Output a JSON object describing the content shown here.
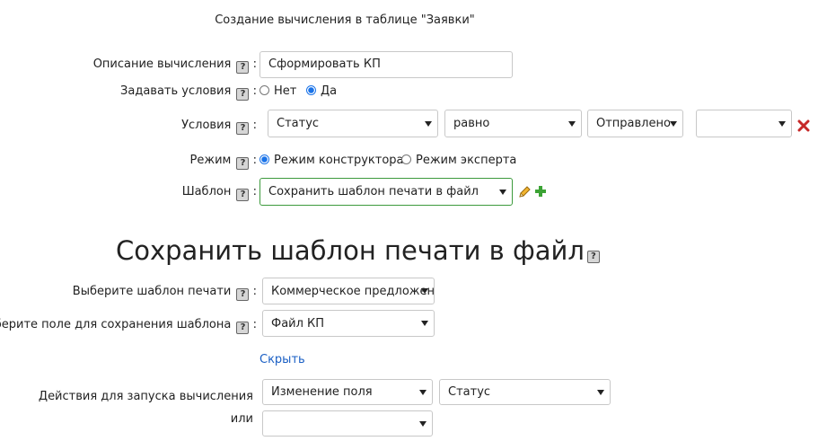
{
  "form_title": "Создание вычисления в таблице \"Заявки\"",
  "help_glyph": "?",
  "description": {
    "label": "Описание вычисления",
    "value": "Сформировать КП"
  },
  "set_conditions": {
    "label": "Задавать условия",
    "options": [
      {
        "label": "Нет",
        "selected": false
      },
      {
        "label": "Да",
        "selected": true
      }
    ]
  },
  "conditions": {
    "label": "Условия",
    "field": "Статус",
    "operator": "равно",
    "value": "Отправлено",
    "extra": ""
  },
  "mode": {
    "label": "Режим",
    "options": [
      {
        "label": "Режим конструктора",
        "selected": true
      },
      {
        "label": "Режим эксперта",
        "selected": false
      }
    ]
  },
  "template": {
    "label": "Шаблон",
    "value": "Сохранить шаблон печати в файл"
  },
  "section": {
    "heading": "Сохранить шаблон печати в файл",
    "print_template": {
      "label": "Выберите шаблон печати",
      "value": "Коммерческое предложение"
    },
    "save_field": {
      "label": "Выберите поле для сохранения шаблона",
      "value": "Файл КП"
    },
    "hide_link": "Скрыть",
    "triggers": {
      "label": "Действия для запуска вычисления",
      "or_label": "или",
      "action": "Изменение поля",
      "field": "Статус",
      "alt_action": ""
    }
  },
  "colors": {
    "accent": "#1a73e8",
    "focus_border": "#3c9a3c",
    "delete": "#c62828",
    "add": "#3ca335",
    "link": "#1a5fc4"
  }
}
